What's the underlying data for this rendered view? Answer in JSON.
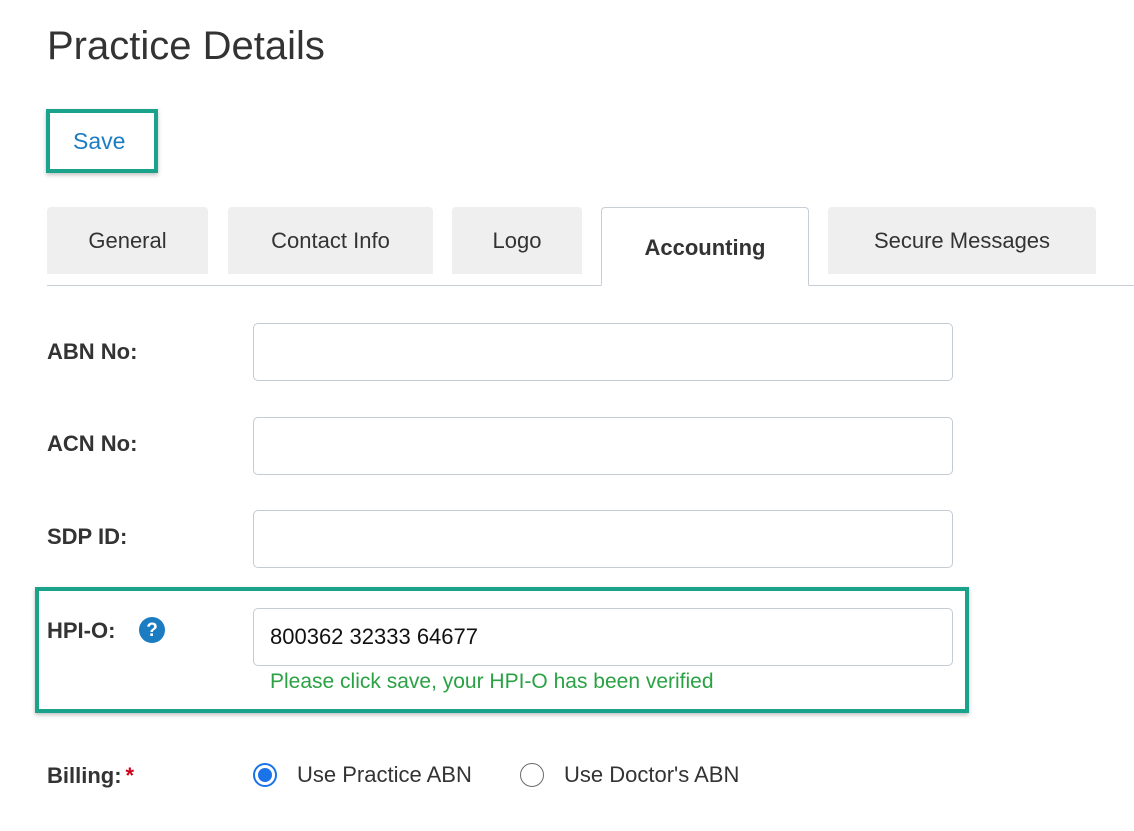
{
  "page": {
    "title": "Practice Details"
  },
  "toolbar": {
    "save_label": "Save"
  },
  "tabs": [
    {
      "label": "General",
      "active": false
    },
    {
      "label": "Contact Info",
      "active": false
    },
    {
      "label": "Logo",
      "active": false
    },
    {
      "label": "Accounting",
      "active": true
    },
    {
      "label": "Secure Messages",
      "active": false
    }
  ],
  "form": {
    "abn": {
      "label": "ABN No:",
      "value": ""
    },
    "acn": {
      "label": "ACN No:",
      "value": ""
    },
    "sdp": {
      "label": "SDP ID:",
      "value": ""
    },
    "hpio": {
      "label": "HPI-O:",
      "value": "800362 32333 64677",
      "help_icon": "question-circle-icon",
      "message": "Please click save, your HPI-O has been verified"
    },
    "billing": {
      "label": "Billing:",
      "required_marker": "*",
      "options": [
        {
          "label": "Use Practice ABN",
          "checked": true
        },
        {
          "label": "Use Doctor's ABN",
          "checked": false
        }
      ]
    }
  },
  "colors": {
    "highlight": "#1aa38a",
    "link": "#1c7cc2",
    "success": "#2aa244",
    "required": "#d0021b",
    "radio_checked": "#1a73e8"
  }
}
